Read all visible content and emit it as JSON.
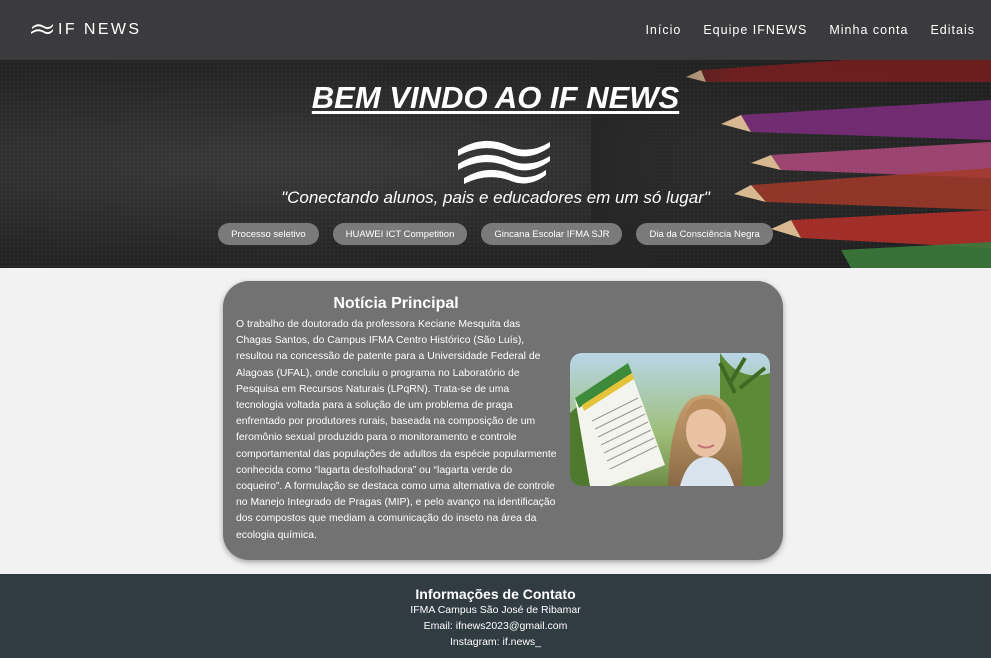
{
  "brand": {
    "name": "IF NEWS",
    "icon": "waves-icon"
  },
  "nav": {
    "links": [
      "Início",
      "Equipe IFNEWS",
      "Minha conta",
      "Editais"
    ]
  },
  "hero": {
    "title": "BEM VINDO AO IF NEWS",
    "tagline": "\"Conectando alunos, pais e educadores em um só lugar\"",
    "tags": [
      "Processo seletivo",
      "HUAWEI ICT Competition",
      "Gincana Escolar IFMA SJR",
      "Dia da Consciência Negra"
    ]
  },
  "news": {
    "title": "Notícia Principal",
    "body": "O trabalho de doutorado da professora Keciane Mesquita das Chagas Santos, do Campus IFMA Centro Histórico (São Luís), resultou na concessão de patente para a Universidade Federal de Alagoas (UFAL), onde concluiu o programa no Laboratório de Pesquisa em Recursos Naturais (LPqRN). Trata-se de uma tecnologia voltada para a solução de um problema de praga enfrentado por produtores rurais, baseada na composição de um feromônio sexual produzido para o monitoramento e controle comportamental das populações de adultos da espécie popularmente conhecida como “lagarta desfolhadora” ou “lagarta verde do coqueiro”. A formulação se destaca como uma alternativa de controle no Manejo Integrado de Pragas (MIP), e pelo avanço na identificação dos compostos que mediam a comunicação do inseto na área da ecologia química."
  },
  "footer": {
    "title": "Informações de Contato",
    "campus": "IFMA Campus São José de Ribamar",
    "email": "Email: ifnews2023@gmail.com",
    "instagram": "Instagram: if.news_"
  },
  "colors": {
    "navbar": "#3b3b3e",
    "card": "#727272",
    "tag": "#7a7a7a",
    "footer": "#313b42",
    "page": "#f2f2f2"
  }
}
